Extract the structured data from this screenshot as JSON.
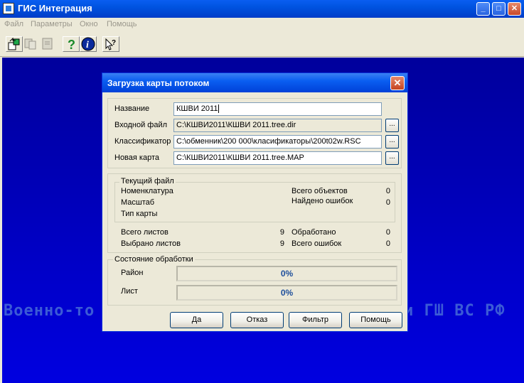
{
  "app": {
    "title": "ГИС Интеграция",
    "controls": {
      "minimize": "_",
      "maximize": "□",
      "close": "✕"
    }
  },
  "menu": [
    "Файл",
    "Параметры",
    "Окно",
    "Помощь"
  ],
  "toolbar": {
    "icons": [
      "open-map-icon",
      "copy-map-icon",
      "paste-map-icon",
      "help-icon",
      "info-icon",
      "context-help-icon"
    ],
    "help_glyph": "?",
    "info_glyph": "i"
  },
  "workspace": {
    "banner_left": "Военно-то",
    "banner_right": "и ГШ ВС РФ",
    "gradient": [
      "#00009c",
      "#0000e0"
    ]
  },
  "dialog": {
    "title": "Загрузка карты потоком",
    "close_glyph": "✕",
    "fields": [
      {
        "label": "Название",
        "value": "КШВИ 2011"
      },
      {
        "label": "Входной файл",
        "value": "C:\\КШВИ2011\\КШВИ 2011.tree.dir"
      },
      {
        "label": "Классификатор",
        "value": "C:\\обменник\\200 000\\класификаторы\\200t02w.RSC"
      },
      {
        "label": "Новая карта",
        "value": "C:\\КШВИ2011\\КШВИ 2011.tree.MAP"
      }
    ],
    "browse_label": "...",
    "current_file": {
      "legend": "Текущий файл",
      "nomenclature_label": "Номенклатура",
      "scale_label": "Масштаб",
      "map_type_label": "Тип карты",
      "total_objects_label": "Всего объектов",
      "total_objects": "0",
      "errors_found_label": "Найдено ошибок",
      "errors_found": "0"
    },
    "stats": {
      "total_sheets_label": "Всего листов",
      "total_sheets": "9",
      "processed_label": "Обработано",
      "processed": "0",
      "selected_sheets_label": "Выбрано листов",
      "selected_sheets": "9",
      "total_errors_label": "Всего ошибок",
      "total_errors": "0"
    },
    "progress": {
      "legend": "Состояние обработки",
      "region_label": "Район",
      "region_value": "0%",
      "region_fraction": 0,
      "sheet_label": "Лист",
      "sheet_value": "0%",
      "sheet_fraction": 0
    },
    "buttons": {
      "ok": "Да",
      "cancel": "Отказ",
      "filter": "Фильтр",
      "help": "Помощь"
    }
  }
}
